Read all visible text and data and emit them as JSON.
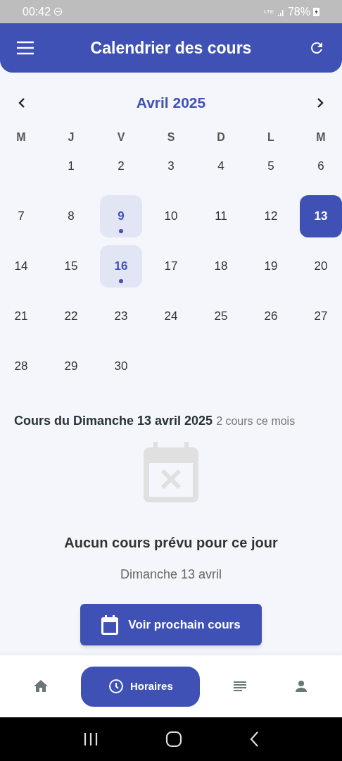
{
  "status_bar": {
    "time": "00:42",
    "network": "LTE",
    "battery": "78%"
  },
  "header": {
    "title": "Calendrier des cours"
  },
  "calendar": {
    "month": "Avril 2025",
    "weekdays": [
      "M",
      "J",
      "V",
      "S",
      "D",
      "L",
      "M"
    ],
    "weeks": [
      [
        {
          "day": "1",
          "selected": false,
          "has_course": false
        },
        {
          "day": "2",
          "selected": false,
          "has_course": false
        },
        {
          "day": "3",
          "selected": false,
          "has_course": false
        },
        {
          "day": "4",
          "selected": false,
          "has_course": false
        },
        {
          "day": "5",
          "selected": false,
          "has_course": false
        },
        {
          "day": "6",
          "selected": false,
          "has_course": false
        }
      ],
      [
        {
          "day": "7",
          "selected": false,
          "has_course": false
        },
        {
          "day": "8",
          "selected": false,
          "has_course": false
        },
        {
          "day": "9",
          "selected": false,
          "has_course": true
        },
        {
          "day": "10",
          "selected": false,
          "has_course": false
        },
        {
          "day": "11",
          "selected": false,
          "has_course": false
        },
        {
          "day": "12",
          "selected": false,
          "has_course": false
        },
        {
          "day": "13",
          "selected": true,
          "has_course": false
        }
      ],
      [
        {
          "day": "14",
          "selected": false,
          "has_course": false
        },
        {
          "day": "15",
          "selected": false,
          "has_course": false
        },
        {
          "day": "16",
          "selected": false,
          "has_course": true
        },
        {
          "day": "17",
          "selected": false,
          "has_course": false
        },
        {
          "day": "18",
          "selected": false,
          "has_course": false
        },
        {
          "day": "19",
          "selected": false,
          "has_course": false
        },
        {
          "day": "20",
          "selected": false,
          "has_course": false
        }
      ],
      [
        {
          "day": "21",
          "selected": false,
          "has_course": false
        },
        {
          "day": "22",
          "selected": false,
          "has_course": false
        },
        {
          "day": "23",
          "selected": false,
          "has_course": false
        },
        {
          "day": "24",
          "selected": false,
          "has_course": false
        },
        {
          "day": "25",
          "selected": false,
          "has_course": false
        },
        {
          "day": "26",
          "selected": false,
          "has_course": false
        },
        {
          "day": "27",
          "selected": false,
          "has_course": false
        }
      ],
      [
        {
          "day": "28",
          "selected": false,
          "has_course": false
        },
        {
          "day": "29",
          "selected": false,
          "has_course": false
        },
        {
          "day": "30",
          "selected": false,
          "has_course": false
        }
      ]
    ]
  },
  "day_section": {
    "title": "Cours du Dimanche 13 avril 2025",
    "count": "2 cours ce mois",
    "empty_title": "Aucun cours prévu pour ce jour",
    "empty_date": "Dimanche 13 avril",
    "button": "Voir prochain cours"
  },
  "bottom_nav": [
    {
      "kind": "home",
      "selected": false
    },
    {
      "kind": "schedule",
      "label": "Horaires",
      "selected": true
    },
    {
      "kind": "list",
      "selected": false
    },
    {
      "kind": "profile",
      "selected": false
    }
  ]
}
